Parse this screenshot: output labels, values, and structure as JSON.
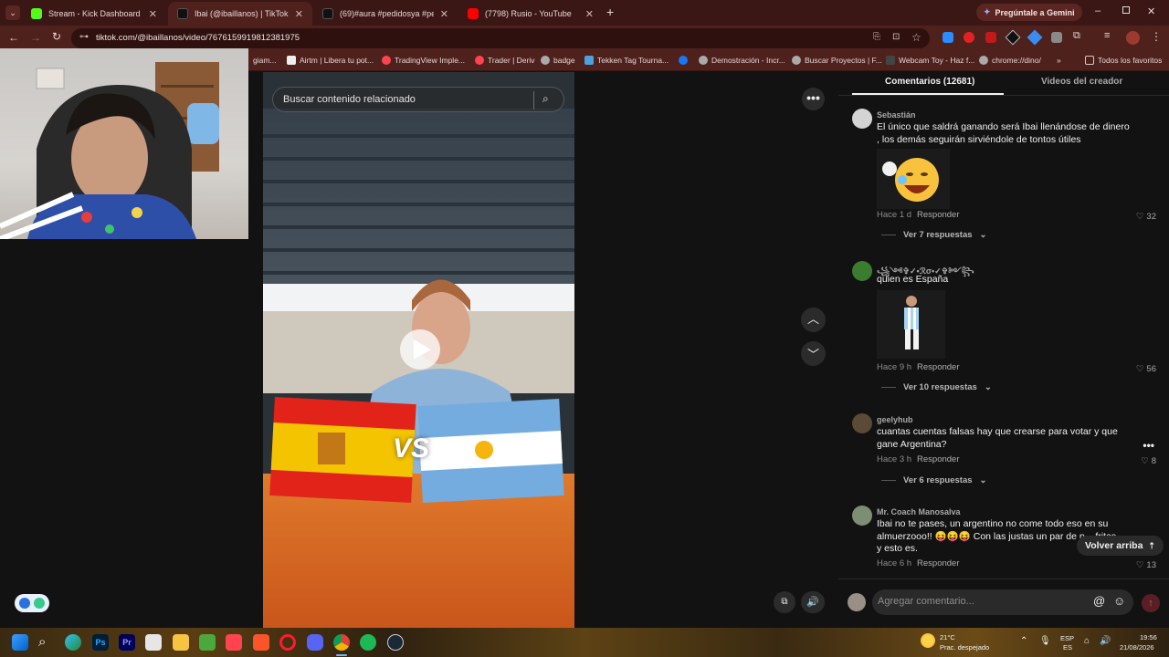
{
  "browser": {
    "tabs": [
      {
        "title": "Stream - Kick Dashboard",
        "favicon_color": "#53fc18"
      },
      {
        "title": "Ibai (@ibaillanos) | TikTok",
        "favicon_color": "#111111"
      },
      {
        "title": "(69)#aura #pedidosya #pedido",
        "favicon_color": "#111111"
      },
      {
        "title": "(7798) Rusio - YouTube",
        "favicon_color": "#ff0000"
      }
    ],
    "gemini_button": "Pregúntale a Gemini",
    "url": "tiktok.com/@ibaillanos/video/7676159919812381975",
    "bookmarks": [
      {
        "label": "giam..."
      },
      {
        "label": "Airtm | Libera tu pot..."
      },
      {
        "label": "TradingView Imple..."
      },
      {
        "label": "Trader | Deriv"
      },
      {
        "label": "badge"
      },
      {
        "label": "Tekken Tag Tourna..."
      },
      {
        "label": "Demostración - Incr..."
      },
      {
        "label": "Buscar Proyectos | F..."
      },
      {
        "label": "Webcam Toy - Haz f..."
      },
      {
        "label": "chrome://dino/"
      }
    ],
    "all_favorites": "Todos los favoritos"
  },
  "video": {
    "search_placeholder": "Buscar contenido relacionado",
    "overlay_text": "VS"
  },
  "comments_panel": {
    "tab_comments": "Comentarios (12681)",
    "tab_creator_videos": "Videos del creador",
    "reply_label": "Responder",
    "comments": [
      {
        "user": "Sebastián",
        "text": "El único que saldrá ganando será Ibai llenándose de dinero , los demás seguirán sirviéndole de tontos útiles",
        "time": "Hace 1 d",
        "likes": "32",
        "replies": "Ver 7 respuestas"
      },
      {
        "user": "꧁༺✞✓•ℛσ•✓✞༻꧂",
        "text": "quien es España",
        "time": "Hace 9 h",
        "likes": "56",
        "replies": "Ver 10 respuestas"
      },
      {
        "user": "geelyhub",
        "text": "cuantas cuentas falsas hay que crearse para votar y que gane Argentina?",
        "time": "Hace 3 h",
        "likes": "8",
        "replies": "Ver 6 respuestas"
      },
      {
        "user": "Mr. Coach Manosalva",
        "text": "Ibai no te pases, un argentino no come todo eso en su almuerzooo!! 😝😝😝 Con las justas un par de p... fritas y esto es.",
        "time": "Hace 6 h",
        "likes": "13"
      }
    ],
    "back_to_top": "Volver arriba",
    "add_comment_placeholder": "Agregar comentario..."
  },
  "taskbar": {
    "weather_temp": "21°C",
    "weather_desc": "Prac. despejado",
    "lang_top": "ESP",
    "lang_bottom": "ES",
    "time": "19:56",
    "date": "21/08/2026"
  }
}
